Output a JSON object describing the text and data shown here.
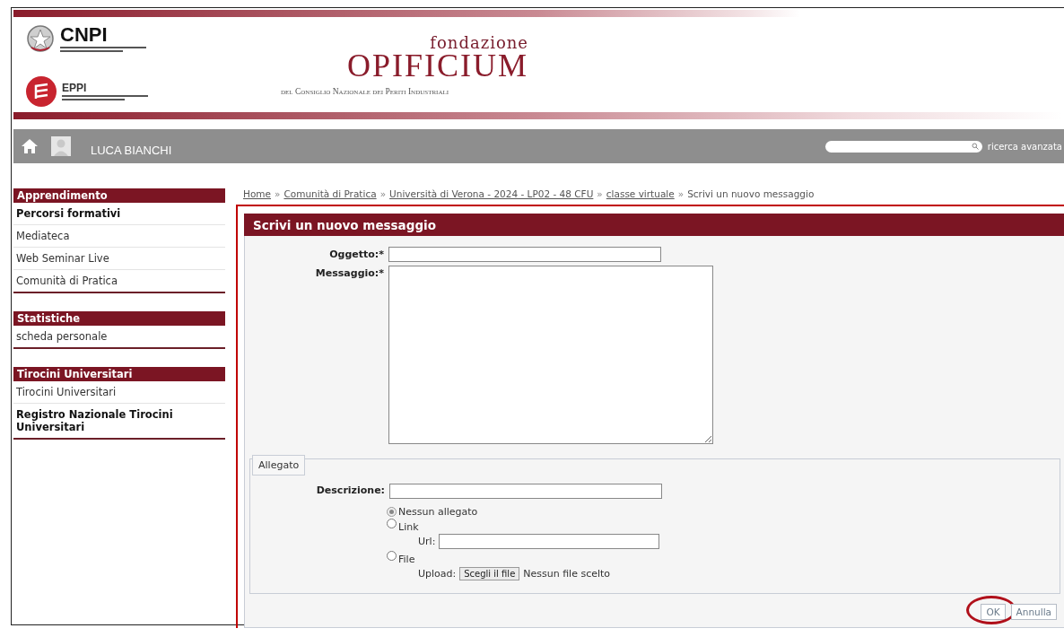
{
  "header": {
    "cnpi": "CNPI",
    "eppi": "EPPI",
    "kicker": "fondazione",
    "name": "OPIFICIUM",
    "subtitle": "del Consiglio Nazionale dei Periti Industriali"
  },
  "nav": {
    "user": "LUCA BIANCHI",
    "advanced_search": "ricerca avanzata"
  },
  "sidebar": {
    "sections": [
      {
        "title": "Apprendimento",
        "items": [
          {
            "label": "Percorsi formativi",
            "emphasized": true
          },
          {
            "label": "Mediateca",
            "emphasized": false
          },
          {
            "label": "Web Seminar Live",
            "emphasized": false
          },
          {
            "label": "Comunità di Pratica",
            "emphasized": false
          }
        ]
      },
      {
        "title": "Statistiche",
        "items": [
          {
            "label": "scheda personale",
            "emphasized": false
          }
        ]
      },
      {
        "title": "Tirocini Universitari",
        "items": [
          {
            "label": "Tirocini Universitari",
            "emphasized": false
          },
          {
            "label": "Registro Nazionale Tirocini Universitari",
            "emphasized": true
          }
        ]
      }
    ]
  },
  "breadcrumb_separator": "»",
  "breadcrumb": [
    {
      "label": "Home",
      "link": true
    },
    {
      "label": "Comunità di Pratica",
      "link": true
    },
    {
      "label": "Università di Verona - 2024 - LP02 - 48 CFU",
      "link": true
    },
    {
      "label": "classe virtuale",
      "link": true
    },
    {
      "label": "Scrivi un nuovo messaggio",
      "link": false
    }
  ],
  "form": {
    "title": "Scrivi un nuovo messaggio",
    "outlined": true,
    "subject_label": "Oggetto:*",
    "message_label": "Messaggio:*",
    "attachment": {
      "legend": "Allegato",
      "description_label": "Descrizione:",
      "options": [
        {
          "kind": "none",
          "label": "Nessun allegato",
          "selected": true
        },
        {
          "kind": "link",
          "label": "Link",
          "selected": false,
          "field_label": "Url:"
        },
        {
          "kind": "file",
          "label": "File",
          "selected": false,
          "field_label": "Upload:",
          "button": "Scegli il file",
          "status": "Nessun file scelto"
        }
      ]
    },
    "buttons": [
      {
        "label": "OK",
        "circled": true
      },
      {
        "label": "Annulla",
        "circled": false
      }
    ]
  }
}
